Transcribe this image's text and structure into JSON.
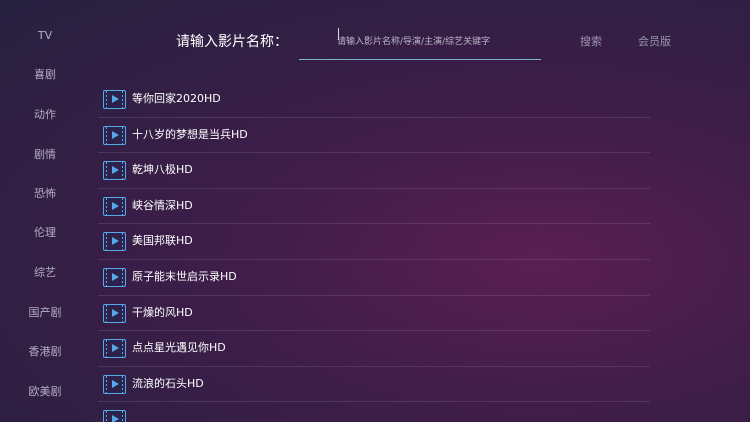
{
  "sidebar": {
    "items": [
      {
        "label": "TV"
      },
      {
        "label": "喜剧"
      },
      {
        "label": "动作"
      },
      {
        "label": "剧情"
      },
      {
        "label": "恐怖"
      },
      {
        "label": "伦理"
      },
      {
        "label": "综艺"
      },
      {
        "label": "国产剧"
      },
      {
        "label": "香港剧"
      },
      {
        "label": "欧美剧"
      }
    ]
  },
  "search": {
    "label": "请输入影片名称：",
    "value": "",
    "placeholder": "请输入影片名称/导演/主演/综艺关键字",
    "search_button": "搜索",
    "vip_button": "会员版"
  },
  "results": [
    {
      "title": "等你回家2020HD"
    },
    {
      "title": "十八岁的梦想是当兵HD"
    },
    {
      "title": "乾坤八极HD"
    },
    {
      "title": "峡谷情深HD"
    },
    {
      "title": "美国邦联HD"
    },
    {
      "title": "原子能末世启示录HD"
    },
    {
      "title": "干燥的风HD"
    },
    {
      "title": "点点星光遇见你HD"
    },
    {
      "title": "流浪的石头HD"
    },
    {
      "title": ""
    }
  ],
  "colors": {
    "accent": "#56a8e6",
    "input_underline": "#7fb2d0",
    "background": "#3c1e48"
  }
}
